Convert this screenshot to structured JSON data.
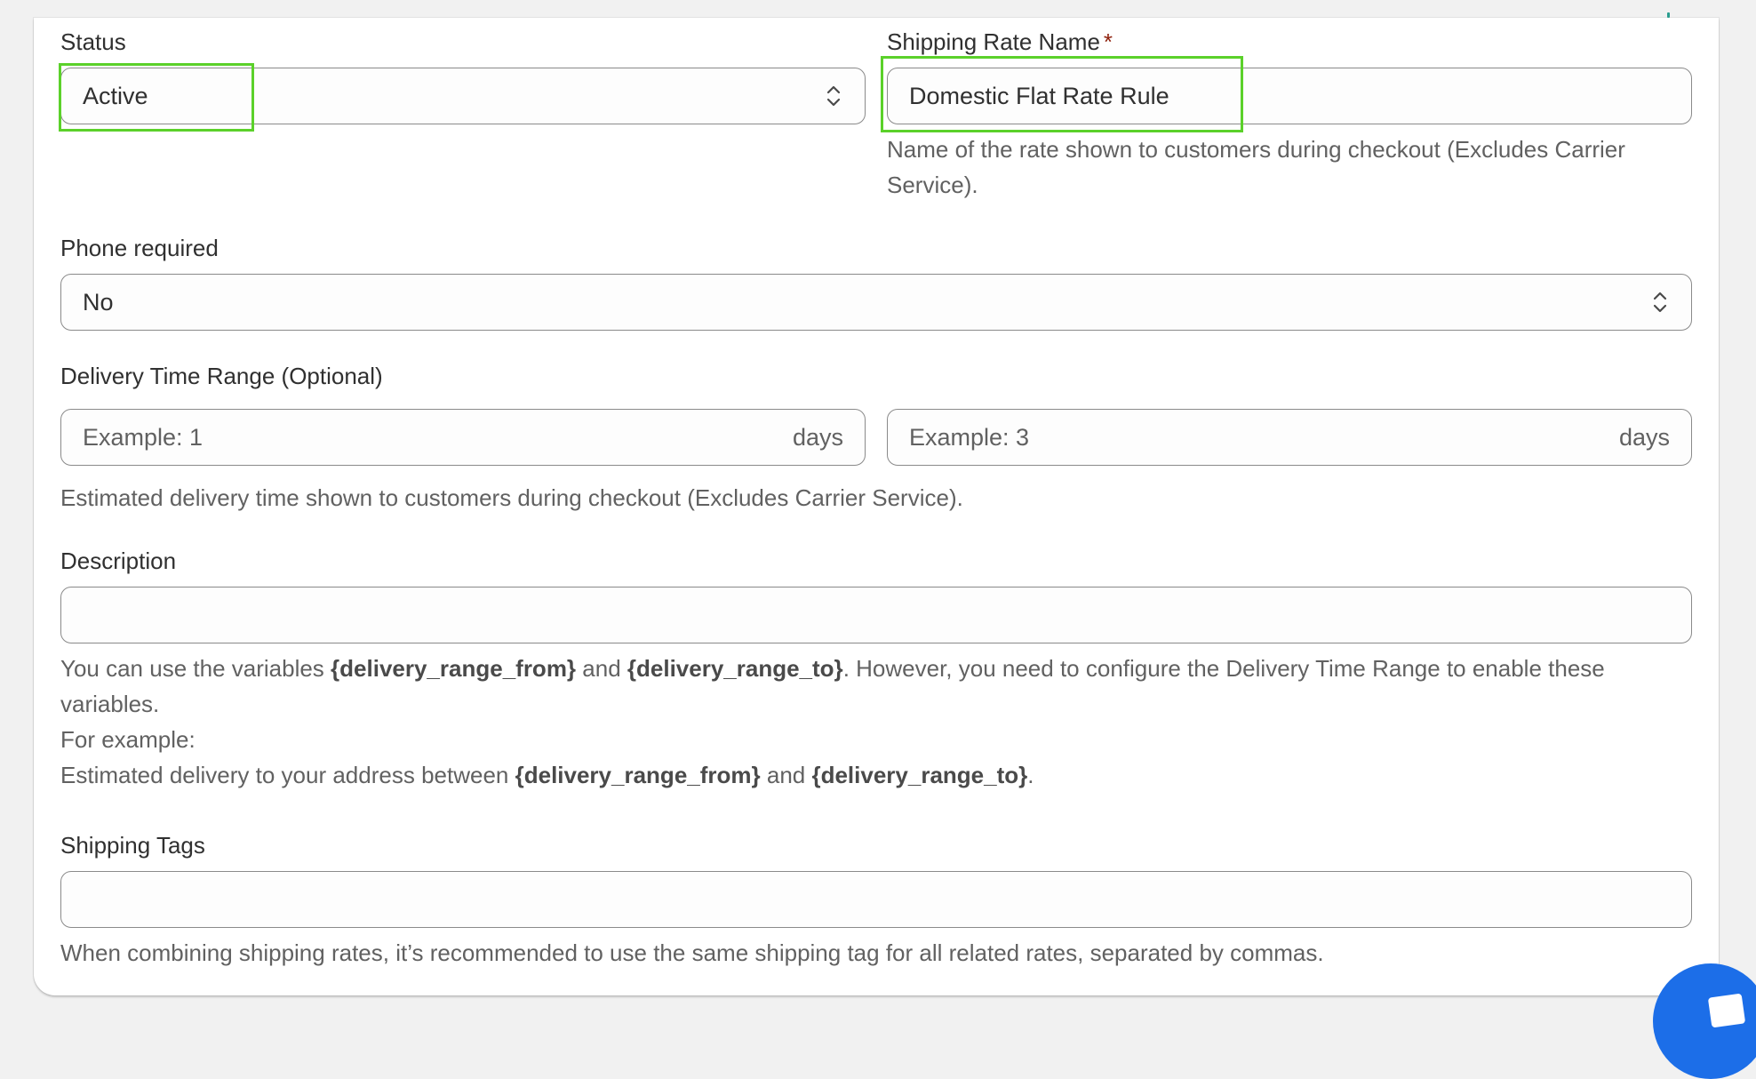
{
  "status": {
    "label": "Status",
    "value": "Active"
  },
  "shipping_rate_name": {
    "label": "Shipping Rate Name",
    "required_mark": "*",
    "value": "Domestic Flat Rate Rule",
    "help": "Name of the rate shown to customers during checkout (Excludes Carrier Service)."
  },
  "phone_required": {
    "label": "Phone required",
    "value": "No"
  },
  "delivery_time_range": {
    "label": "Delivery Time Range (Optional)",
    "from_placeholder": "Example: 1",
    "to_placeholder": "Example: 3",
    "unit": "days",
    "help": "Estimated delivery time shown to customers during checkout (Excludes Carrier Service)."
  },
  "description": {
    "label": "Description",
    "value": "",
    "help": {
      "part1": "You can use the variables ",
      "var_from": "{delivery_range_from}",
      "and": " and ",
      "var_to": "{delivery_range_to}",
      "part2": ". However, you need to configure the Delivery Time Range to enable these variables.",
      "example_label": "For example:",
      "example_prefix": "Estimated delivery to your address between ",
      "example_suffix": "."
    }
  },
  "shipping_tags": {
    "label": "Shipping Tags",
    "value": "",
    "help": "When combining shipping rates, it’s recommended to use the same shipping tag for all related rates, separated by commas."
  },
  "colors": {
    "highlight": "#5bd12a",
    "required": "#8e1f0b",
    "fab": "#1c6ee8"
  },
  "icons": {
    "select_chevron": "chevron-up-down-icon",
    "chat_fab": "chat-icon"
  }
}
